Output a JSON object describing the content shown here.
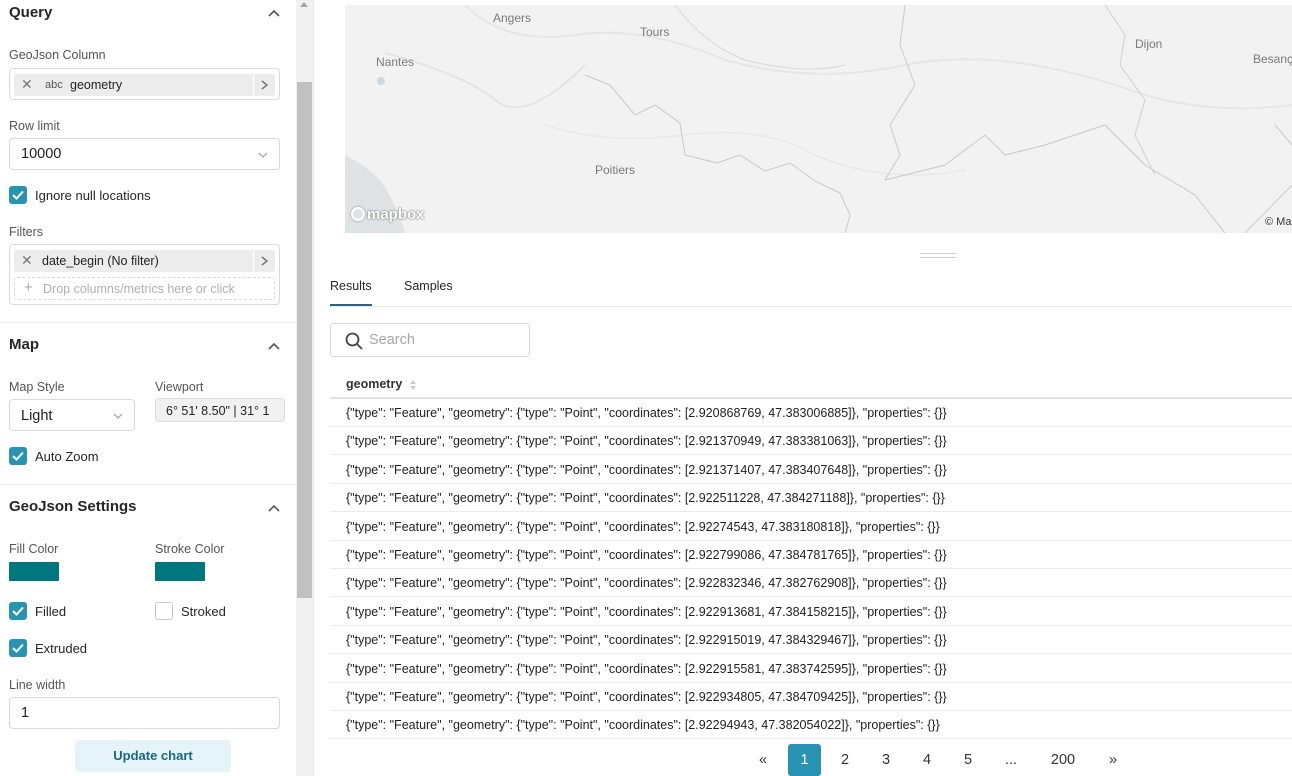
{
  "query": {
    "title": "Query",
    "geojson_label": "GeoJson Column",
    "geojson_type": "abc",
    "geojson_value": "geometry",
    "row_limit_label": "Row limit",
    "row_limit_value": "10000",
    "ignore_null_label": "Ignore null locations",
    "filters_label": "Filters",
    "filter_chip": "date_begin (No filter)",
    "drop_placeholder": "Drop columns/metrics here or click"
  },
  "map_section": {
    "title": "Map",
    "style_label": "Map Style",
    "style_value": "Light",
    "viewport_label": "Viewport",
    "viewport_value": "6° 51' 8.50\" | 31° 1",
    "auto_zoom_label": "Auto Zoom"
  },
  "geojson_settings": {
    "title": "GeoJson Settings",
    "fill_color_label": "Fill Color",
    "stroke_color_label": "Stroke Color",
    "fill_color": "#00767f",
    "stroke_color": "#00767f",
    "filled_label": "Filled",
    "stroked_label": "Stroked",
    "extruded_label": "Extruded",
    "line_width_label": "Line width",
    "line_width_value": "1",
    "update_button": "Update chart"
  },
  "map": {
    "cities": [
      "Angers",
      "Tours",
      "Nantes",
      "Dijon",
      "Besanç",
      "Poitiers"
    ],
    "logo": "mapbox",
    "copyright": "© Ma"
  },
  "tabs": [
    "Results",
    "Samples"
  ],
  "search_placeholder": "Search",
  "table": {
    "column": "geometry",
    "rows": [
      "{\"type\": \"Feature\", \"geometry\": {\"type\": \"Point\", \"coordinates\": [2.920868769, 47.383006885]}, \"properties\": {}}",
      "{\"type\": \"Feature\", \"geometry\": {\"type\": \"Point\", \"coordinates\": [2.921370949, 47.383381063]}, \"properties\": {}}",
      "{\"type\": \"Feature\", \"geometry\": {\"type\": \"Point\", \"coordinates\": [2.921371407, 47.383407648]}, \"properties\": {}}",
      "{\"type\": \"Feature\", \"geometry\": {\"type\": \"Point\", \"coordinates\": [2.922511228, 47.384271188]}, \"properties\": {}}",
      "{\"type\": \"Feature\", \"geometry\": {\"type\": \"Point\", \"coordinates\": [2.92274543, 47.383180818]}, \"properties\": {}}",
      "{\"type\": \"Feature\", \"geometry\": {\"type\": \"Point\", \"coordinates\": [2.922799086, 47.384781765]}, \"properties\": {}}",
      "{\"type\": \"Feature\", \"geometry\": {\"type\": \"Point\", \"coordinates\": [2.922832346, 47.382762908]}, \"properties\": {}}",
      "{\"type\": \"Feature\", \"geometry\": {\"type\": \"Point\", \"coordinates\": [2.922913681, 47.384158215]}, \"properties\": {}}",
      "{\"type\": \"Feature\", \"geometry\": {\"type\": \"Point\", \"coordinates\": [2.922915019, 47.384329467]}, \"properties\": {}}",
      "{\"type\": \"Feature\", \"geometry\": {\"type\": \"Point\", \"coordinates\": [2.922915581, 47.383742595]}, \"properties\": {}}",
      "{\"type\": \"Feature\", \"geometry\": {\"type\": \"Point\", \"coordinates\": [2.922934805, 47.384709425]}, \"properties\": {}}",
      "{\"type\": \"Feature\", \"geometry\": {\"type\": \"Point\", \"coordinates\": [2.92294943, 47.382054022]}, \"properties\": {}}"
    ]
  },
  "pagination": {
    "prev": "«",
    "pages": [
      "1",
      "2",
      "3",
      "4",
      "5"
    ],
    "ellipsis": "...",
    "last": "200",
    "next": "»",
    "current": "1"
  }
}
